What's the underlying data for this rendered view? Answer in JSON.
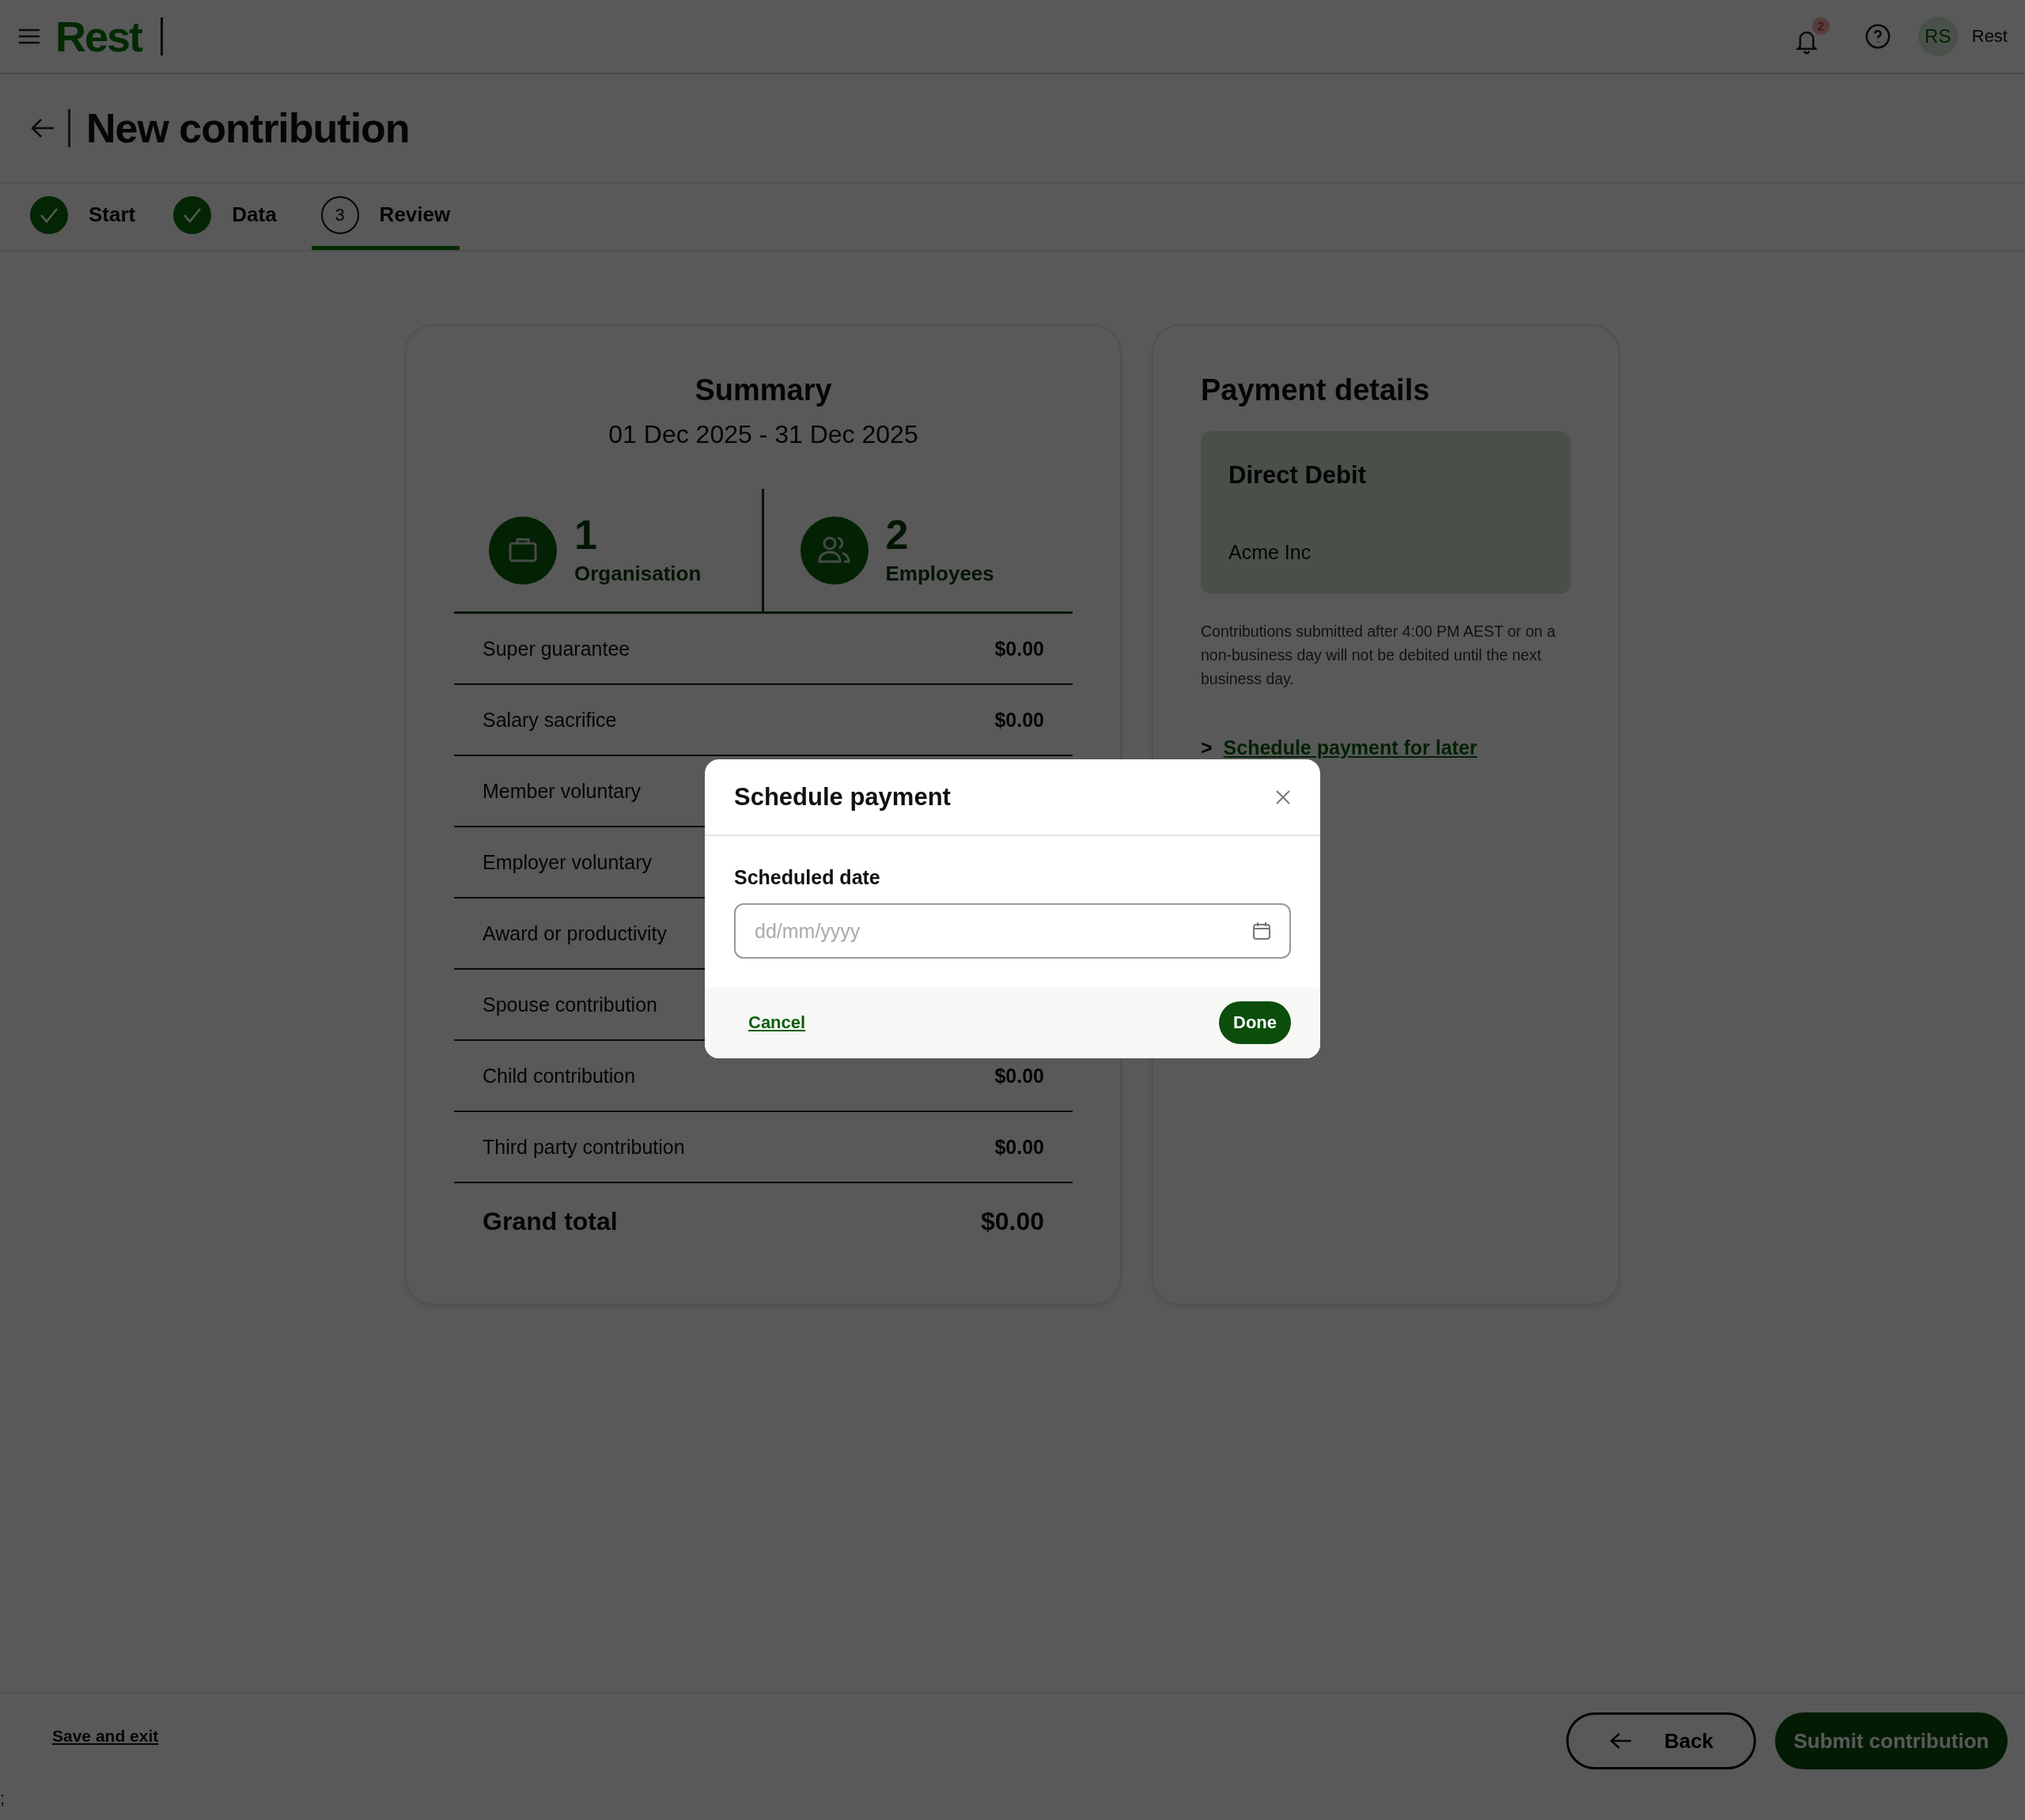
{
  "header": {
    "logo": "Rest",
    "notification_count": "2",
    "avatar_initials": "RS",
    "user_name": "Rest"
  },
  "page_title": "New contribution",
  "steps": [
    {
      "label": "Start",
      "kind": "done",
      "selected": false
    },
    {
      "label": "Data",
      "kind": "done",
      "selected": false
    },
    {
      "label": "Review",
      "kind": "current",
      "number": "3",
      "selected": true
    }
  ],
  "summary": {
    "title": "Summary",
    "period": "01 Dec 2025 - 31 Dec 2025",
    "stats": [
      {
        "kind": "organisation",
        "value": "1",
        "label": "Organisation"
      },
      {
        "kind": "employees",
        "value": "2",
        "label": "Employees"
      }
    ],
    "rows": [
      {
        "label": "Super guarantee",
        "amount": "$0.00"
      },
      {
        "label": "Salary sacrifice",
        "amount": "$0.00"
      },
      {
        "label": "Member voluntary"
      },
      {
        "label": "Employer voluntary"
      },
      {
        "label": "Award or productivity"
      },
      {
        "label": "Spouse contribution"
      },
      {
        "label": "Child contribution",
        "amount": "$0.00"
      },
      {
        "label": "Third party contribution",
        "amount": "$0.00"
      }
    ],
    "total": {
      "label": "Grand total",
      "amount": "$0.00"
    }
  },
  "payment": {
    "title": "Payment details",
    "method": {
      "title": "Direct Debit",
      "payer": "Acme Inc"
    },
    "note": "Contributions submitted after 4:00 PM AEST or on a non-business day will not be debited until the next business day.",
    "schedule_link": {
      "marker": ">",
      "label": "Schedule payment for later"
    }
  },
  "modal": {
    "title": "Schedule payment",
    "field": {
      "label": "Scheduled date",
      "placeholder": "dd/mm/yyyy"
    },
    "cancel": "Cancel",
    "done": "Done"
  },
  "footer": {
    "save_exit": "Save and exit",
    "back": "Back",
    "submit": "Submit contribution",
    "stray_text": ";"
  }
}
